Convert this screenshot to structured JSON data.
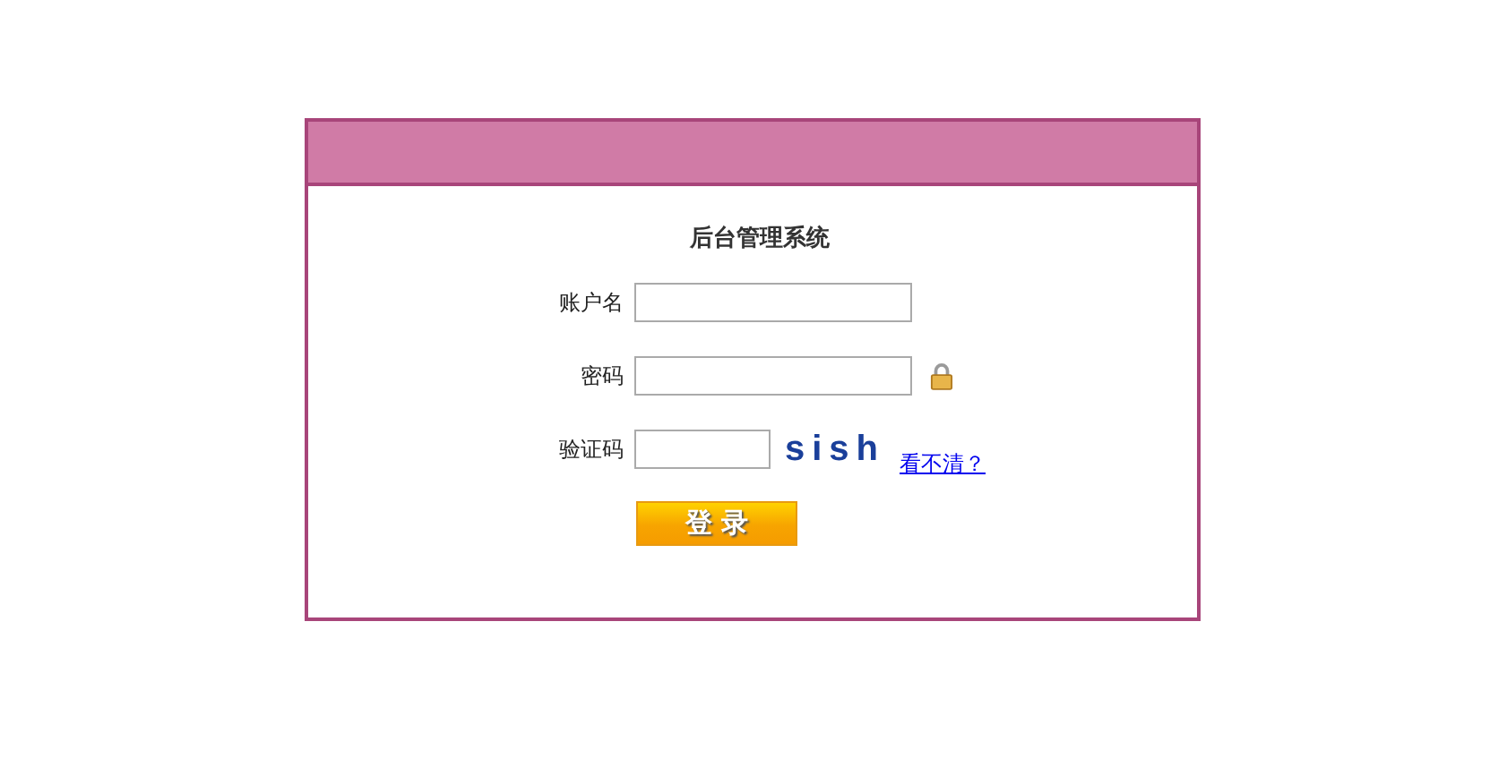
{
  "panel": {
    "title": "后台管理系统"
  },
  "fields": [
    {
      "kind": "text",
      "label": "账户名"
    },
    {
      "kind": "password",
      "label": "密码"
    },
    {
      "kind": "captcha",
      "label": "验证码",
      "captcha": "sish",
      "refresh_link": "看不清？"
    }
  ],
  "login_button": "登 录"
}
